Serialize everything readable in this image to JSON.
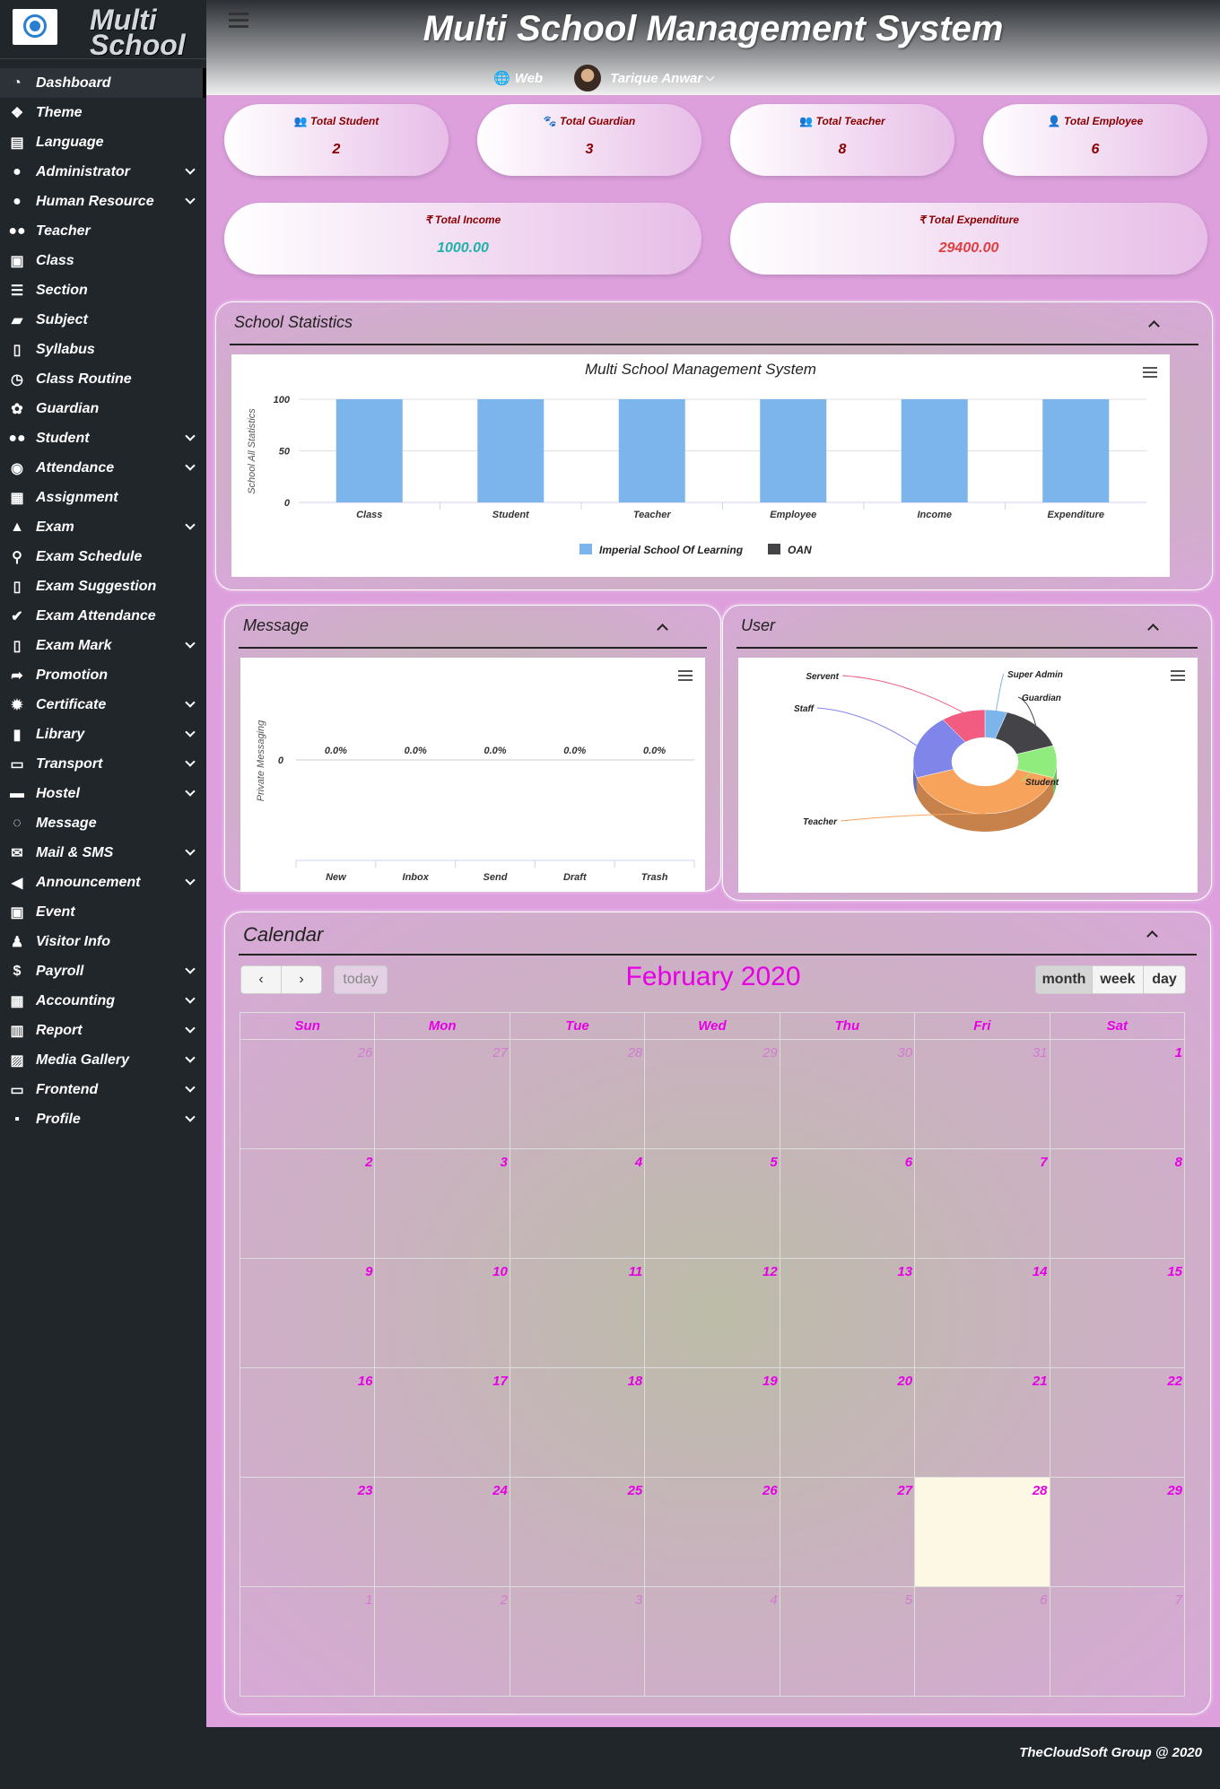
{
  "brand": {
    "line1": "Multi",
    "line2": "School"
  },
  "menu": [
    {
      "label": "Dashboard",
      "icon": "dashboard-icon",
      "has_sub": false,
      "active": true
    },
    {
      "label": "Theme",
      "icon": "theme-icon",
      "has_sub": false
    },
    {
      "label": "Language",
      "icon": "language-icon",
      "has_sub": false
    },
    {
      "label": "Administrator",
      "icon": "user-icon",
      "has_sub": true
    },
    {
      "label": "Human Resource",
      "icon": "user-icon",
      "has_sub": true
    },
    {
      "label": "Teacher",
      "icon": "users-icon",
      "has_sub": false
    },
    {
      "label": "Class",
      "icon": "class-icon",
      "has_sub": false
    },
    {
      "label": "Section",
      "icon": "list-icon",
      "has_sub": false
    },
    {
      "label": "Subject",
      "icon": "folder-icon",
      "has_sub": false
    },
    {
      "label": "Syllabus",
      "icon": "file-icon",
      "has_sub": false
    },
    {
      "label": "Class Routine",
      "icon": "clock-icon",
      "has_sub": false
    },
    {
      "label": "Guardian",
      "icon": "paw-icon",
      "has_sub": false
    },
    {
      "label": "Student",
      "icon": "users-icon",
      "has_sub": true
    },
    {
      "label": "Attendance",
      "icon": "check-circle-icon",
      "has_sub": true
    },
    {
      "label": "Assignment",
      "icon": "assignment-icon",
      "has_sub": false
    },
    {
      "label": "Exam",
      "icon": "graduation-cap-icon",
      "has_sub": true
    },
    {
      "label": "Exam Schedule",
      "icon": "pin-icon",
      "has_sub": false
    },
    {
      "label": "Exam Suggestion",
      "icon": "file-icon",
      "has_sub": false
    },
    {
      "label": "Exam Attendance",
      "icon": "check-icon",
      "has_sub": false
    },
    {
      "label": "Exam Mark",
      "icon": "file-icon",
      "has_sub": true
    },
    {
      "label": "Promotion",
      "icon": "share-icon",
      "has_sub": false
    },
    {
      "label": "Certificate",
      "icon": "certificate-icon",
      "has_sub": true
    },
    {
      "label": "Library",
      "icon": "book-icon",
      "has_sub": true
    },
    {
      "label": "Transport",
      "icon": "bus-icon",
      "has_sub": true
    },
    {
      "label": "Hostel",
      "icon": "bed-icon",
      "has_sub": true
    },
    {
      "label": "Message",
      "icon": "comments-icon",
      "has_sub": false
    },
    {
      "label": "Mail & SMS",
      "icon": "envelope-icon",
      "has_sub": true
    },
    {
      "label": "Announcement",
      "icon": "bullhorn-icon",
      "has_sub": true
    },
    {
      "label": "Event",
      "icon": "calendar-check-icon",
      "has_sub": false
    },
    {
      "label": "Visitor Info",
      "icon": "person-icon",
      "has_sub": false
    },
    {
      "label": "Payroll",
      "icon": "dollar-icon",
      "has_sub": true
    },
    {
      "label": "Accounting",
      "icon": "calculator-icon",
      "has_sub": true
    },
    {
      "label": "Report",
      "icon": "bar-chart-icon",
      "has_sub": true
    },
    {
      "label": "Media Gallery",
      "icon": "image-icon",
      "has_sub": true
    },
    {
      "label": "Frontend",
      "icon": "desktop-icon",
      "has_sub": true
    },
    {
      "label": "Profile",
      "icon": "lock-icon",
      "has_sub": true
    }
  ],
  "header": {
    "title": "Multi School Management System",
    "web": "Web",
    "user": "Tarique Anwar"
  },
  "stats": [
    {
      "label": "Total Student",
      "value": "2"
    },
    {
      "label": "Total Guardian",
      "value": "3"
    },
    {
      "label": "Total Teacher",
      "value": "8"
    },
    {
      "label": "Total Employee",
      "value": "6"
    }
  ],
  "finance": [
    {
      "label": "₹ Total Income",
      "value": "1000.00",
      "color": "#20b2aa"
    },
    {
      "label": "₹ Total Expenditure",
      "value": "29400.00",
      "color": "#e04040"
    }
  ],
  "school_stats": {
    "panel_title": "School Statistics",
    "chart_data": {
      "type": "bar",
      "title": "Multi School Management System",
      "ylabel": "School All Statistics",
      "ylim": [
        0,
        100
      ],
      "yticks": [
        "0",
        "50",
        "100"
      ],
      "categories": [
        "Class",
        "Student",
        "Teacher",
        "Employee",
        "Income",
        "Expenditure"
      ],
      "series": [
        {
          "name": "Imperial School Of Learning",
          "color": "#7cb5ec",
          "values": [
            100,
            100,
            100,
            100,
            100,
            100
          ]
        },
        {
          "name": "OAN",
          "color": "#434348",
          "values": [
            0,
            0,
            0,
            0,
            0,
            0
          ]
        }
      ]
    }
  },
  "message_panel": {
    "panel_title": "Message",
    "chart_data": {
      "type": "bar",
      "ylabel": "Private Messaging",
      "categories": [
        "New",
        "Inbox",
        "Send",
        "Draft",
        "Trash"
      ],
      "values": [
        0,
        0,
        0,
        0,
        0
      ],
      "data_labels": [
        "0.0%",
        "0.0%",
        "0.0%",
        "0.0%",
        "0.0%"
      ],
      "yticks": [
        "0"
      ]
    }
  },
  "user_panel": {
    "panel_title": "User",
    "chart_data": {
      "type": "pie",
      "labels": [
        "Super Admin",
        "Guardian",
        "Student",
        "Teacher",
        "Staff",
        "Servent"
      ],
      "values": [
        1,
        3,
        2,
        8,
        4,
        2
      ],
      "colors": [
        "#7cb5ec",
        "#434348",
        "#90ed7d",
        "#f7a35c",
        "#8085e9",
        "#f15c80"
      ]
    }
  },
  "calendar": {
    "panel_title": "Calendar",
    "month_title": "February 2020",
    "today_label": "today",
    "views": [
      "month",
      "week",
      "day"
    ],
    "days": [
      "Sun",
      "Mon",
      "Tue",
      "Wed",
      "Thu",
      "Fri",
      "Sat"
    ],
    "weeks": [
      [
        "26",
        "27",
        "28",
        "29",
        "30",
        "31",
        "1"
      ],
      [
        "2",
        "3",
        "4",
        "5",
        "6",
        "7",
        "8"
      ],
      [
        "9",
        "10",
        "11",
        "12",
        "13",
        "14",
        "15"
      ],
      [
        "16",
        "17",
        "18",
        "19",
        "20",
        "21",
        "22"
      ],
      [
        "23",
        "24",
        "25",
        "26",
        "27",
        "28",
        "29"
      ],
      [
        "1",
        "2",
        "3",
        "4",
        "5",
        "6",
        "7"
      ]
    ],
    "today": "28"
  },
  "footer": {
    "text": "TheCloudSoft Group @ 2020"
  }
}
